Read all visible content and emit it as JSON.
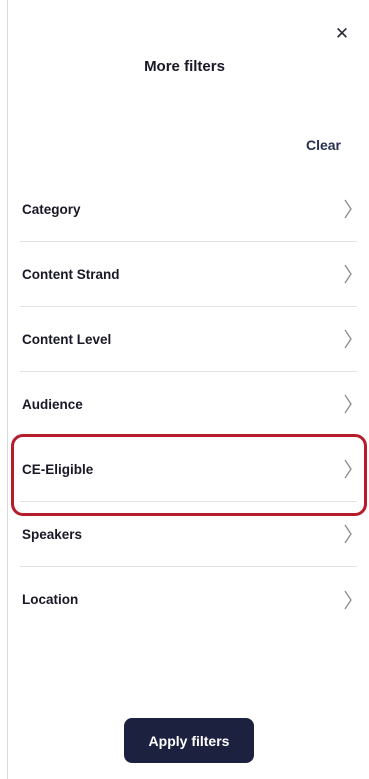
{
  "header": {
    "title": "More filters",
    "close_glyph": "✕",
    "close_icon": "close-icon"
  },
  "actions": {
    "clear_label": "Clear",
    "apply_label": "Apply filters"
  },
  "filters": [
    {
      "label": "Category",
      "icon": "chevron-right-icon"
    },
    {
      "label": "Content Strand",
      "icon": "chevron-right-icon"
    },
    {
      "label": "Content Level",
      "icon": "chevron-right-icon"
    },
    {
      "label": "Audience",
      "icon": "chevron-right-icon"
    },
    {
      "label": "CE-Eligible",
      "icon": "chevron-right-icon",
      "highlighted": true
    },
    {
      "label": "Speakers",
      "icon": "chevron-right-icon"
    },
    {
      "label": "Location",
      "icon": "chevron-right-icon"
    }
  ],
  "colors": {
    "primary_button": "#1d2140",
    "highlight_border": "#b51d2a",
    "text": "#181826"
  }
}
